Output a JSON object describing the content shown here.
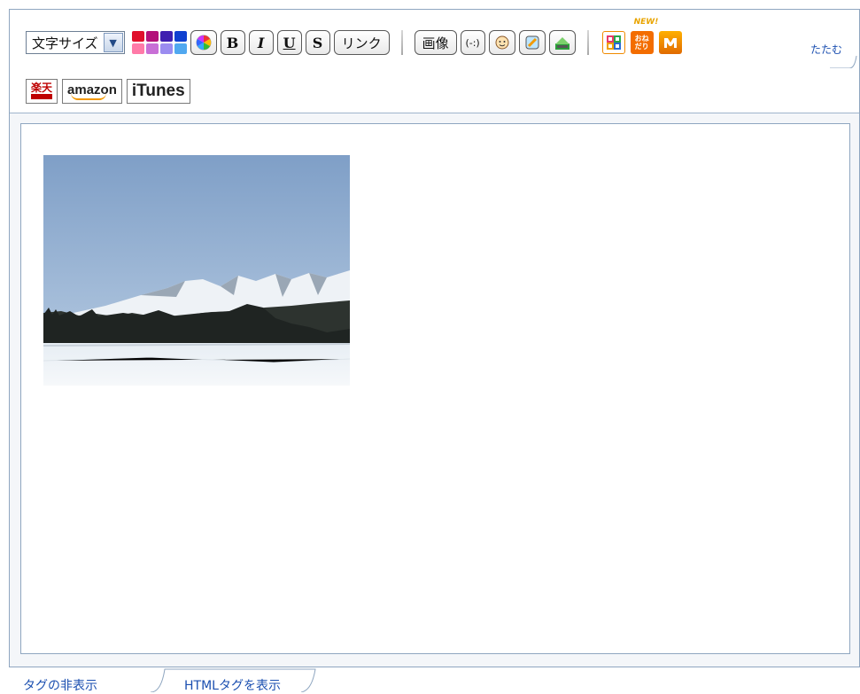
{
  "toolbar": {
    "font_size_select": "文字サイズ",
    "palette_colors": [
      "#e0102c",
      "#b3117a",
      "#3f1fb0",
      "#1040d0",
      "#ff7aa8",
      "#c86fd6",
      "#9b8cf0",
      "#50a8f0"
    ],
    "bold": "B",
    "italic": "I",
    "underline": "U",
    "strike": "S",
    "link": "リンク",
    "image": "画像",
    "emoticon": "(-:)",
    "new_badge": "NEW!",
    "onedari_label": "おね だり",
    "fold": "たたむ"
  },
  "stores": {
    "rakuten": "楽天",
    "amazon": "amazon",
    "itunes": "iTunes"
  },
  "tabs": {
    "hide_tags": "タグの非表示",
    "show_html": "HTMLタグを表示"
  }
}
